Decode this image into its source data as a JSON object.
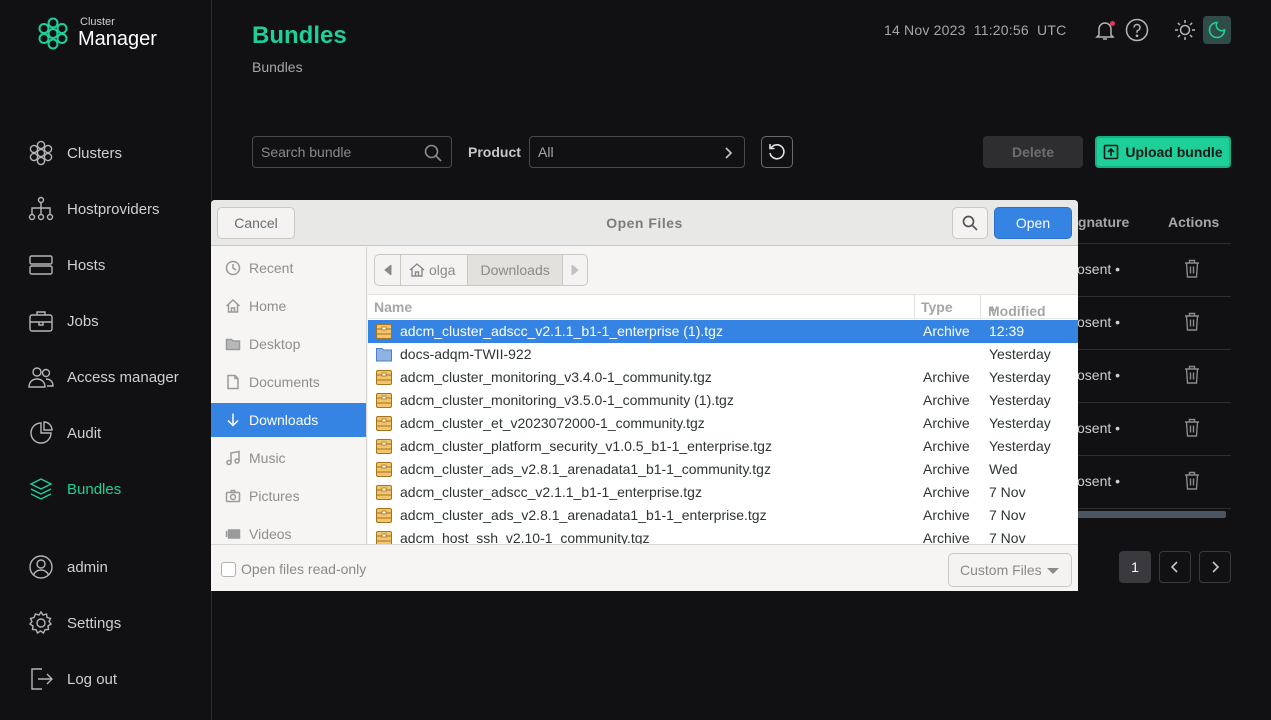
{
  "app": {
    "logo_small": "Cluster",
    "logo_big": "Manager"
  },
  "header": {
    "title": "Bundles",
    "breadcrumb": "Bundles",
    "date": "14 Nov 2023",
    "time": "11:20:56",
    "timezone": "UTC",
    "icons": [
      "bell-icon",
      "help-icon",
      "sun-icon",
      "moon-icon"
    ]
  },
  "sidebar": {
    "items": [
      {
        "label": "Clusters",
        "icon": "clusters-icon"
      },
      {
        "label": "Hostproviders",
        "icon": "hierarchy-icon"
      },
      {
        "label": "Hosts",
        "icon": "server-icon"
      },
      {
        "label": "Jobs",
        "icon": "briefcase-icon"
      },
      {
        "label": "Access manager",
        "icon": "users-icon"
      },
      {
        "label": "Audit",
        "icon": "pie-icon"
      },
      {
        "label": "Bundles",
        "icon": "layers-icon",
        "active": true
      },
      {
        "label": "admin",
        "icon": "user-icon"
      },
      {
        "label": "Settings",
        "icon": "gear-icon"
      },
      {
        "label": "Log out",
        "icon": "logout-icon"
      }
    ]
  },
  "toolbar": {
    "search_placeholder": "Search bundle",
    "product_label": "Product",
    "product_value": "All",
    "delete_label": "Delete",
    "upload_label": "Upload bundle"
  },
  "table": {
    "headers": {
      "signature": "ignature",
      "actions": "Actions"
    },
    "rows": [
      "osent",
      "osent",
      "osent",
      "osent",
      "osent"
    ]
  },
  "pagination": {
    "current_page": "1"
  },
  "colors": {
    "accent": "#1fcf9a",
    "background": "#111113",
    "gtk_blue": "#3584e4"
  },
  "dialog": {
    "title": "Open Files",
    "cancel_label": "Cancel",
    "open_label": "Open",
    "places": [
      {
        "label": "Recent",
        "icon": "clock-icon"
      },
      {
        "label": "Home",
        "icon": "home-icon"
      },
      {
        "label": "Desktop",
        "icon": "folder-icon"
      },
      {
        "label": "Documents",
        "icon": "document-icon"
      },
      {
        "label": "Downloads",
        "icon": "download-icon",
        "active": true
      },
      {
        "label": "Music",
        "icon": "music-icon"
      },
      {
        "label": "Pictures",
        "icon": "camera-icon"
      },
      {
        "label": "Videos",
        "icon": "video-icon"
      }
    ],
    "path": [
      "olga",
      "Downloads"
    ],
    "columns": {
      "name": "Name",
      "type": "Type",
      "modified": "Modified"
    },
    "files": [
      {
        "name": "adcm_cluster_adscc_v2.1.1_b1-1_enterprise (1).tgz",
        "type": "Archive",
        "modified": "12:39",
        "kind": "archive",
        "selected": true
      },
      {
        "name": "docs-adqm-TWII-922",
        "type": "",
        "modified": "Yesterday",
        "kind": "folder"
      },
      {
        "name": "adcm_cluster_monitoring_v3.4.0-1_community.tgz",
        "type": "Archive",
        "modified": "Yesterday",
        "kind": "archive"
      },
      {
        "name": "adcm_cluster_monitoring_v3.5.0-1_community (1).tgz",
        "type": "Archive",
        "modified": "Yesterday",
        "kind": "archive"
      },
      {
        "name": "adcm_cluster_et_v2023072000-1_community.tgz",
        "type": "Archive",
        "modified": "Yesterday",
        "kind": "archive"
      },
      {
        "name": "adcm_cluster_platform_security_v1.0.5_b1-1_enterprise.tgz",
        "type": "Archive",
        "modified": "Yesterday",
        "kind": "archive"
      },
      {
        "name": "adcm_cluster_ads_v2.8.1_arenadata1_b1-1_community.tgz",
        "type": "Archive",
        "modified": "Wed",
        "kind": "archive"
      },
      {
        "name": "adcm_cluster_adscc_v2.1.1_b1-1_enterprise.tgz",
        "type": "Archive",
        "modified": "7 Nov",
        "kind": "archive"
      },
      {
        "name": "adcm_cluster_ads_v2.8.1_arenadata1_b1-1_enterprise.tgz",
        "type": "Archive",
        "modified": "7 Nov",
        "kind": "archive"
      },
      {
        "name": "adcm_host_ssh_v2.10-1_community.tgz",
        "type": "Archive",
        "modified": "7 Nov",
        "kind": "archive"
      }
    ],
    "readonly_label": "Open files read-only",
    "filter_value": "Custom Files"
  }
}
